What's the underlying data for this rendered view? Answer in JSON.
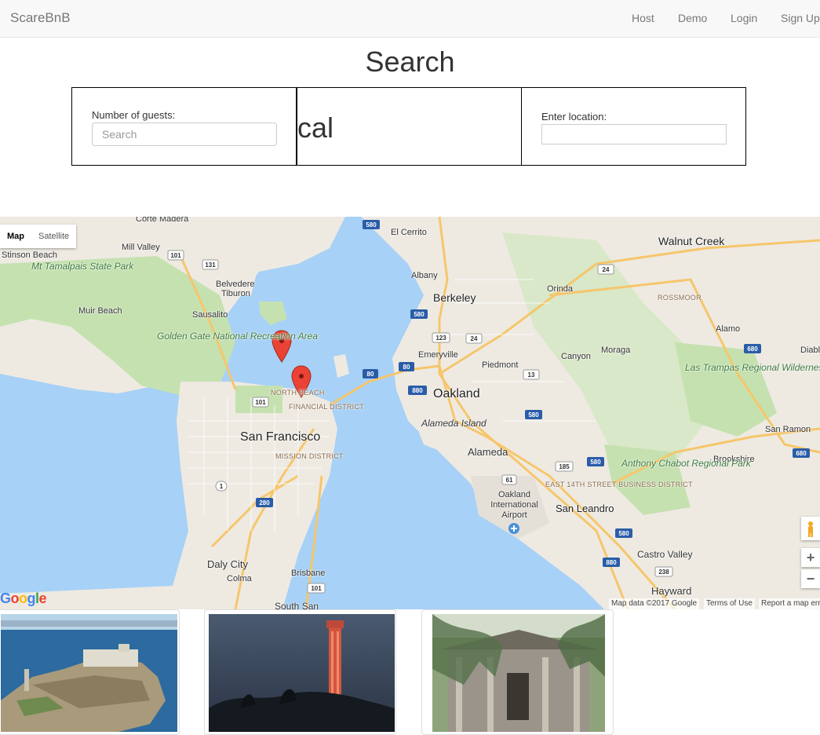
{
  "navbar": {
    "brand": "ScareBnB",
    "links": [
      "Host",
      "Demo",
      "Login",
      "Sign Up"
    ]
  },
  "page_title": "Search",
  "search": {
    "guests_label": "Number of guests:",
    "guests_placeholder": "Search",
    "calendar_text": "cal",
    "location_label": "Enter location:",
    "location_value": ""
  },
  "map": {
    "type_controls": [
      "Map",
      "Satellite"
    ],
    "active_type": "Map",
    "labels": {
      "corte_madera": "Corte Madera",
      "mill_valley": "Mill Valley",
      "stinson_beach": "Stinson Beach",
      "mt_tamalpais": "Mt Tamalpais State Park",
      "belvedere": "Belvedere",
      "tiburon": "Tiburon",
      "muir_beach": "Muir Beach",
      "sausalito": "Sausalito",
      "golden_gate": "Golden Gate National Recreation Area",
      "el_cerrito": "El Cerrito",
      "albany": "Albany",
      "berkeley": "Berkeley",
      "walnut_creek": "Walnut Creek",
      "orinda": "Orinda",
      "rossmoor": "ROSSMOOR",
      "alamo": "Alamo",
      "moraga": "Moraga",
      "canyon": "Canyon",
      "piedmont": "Piedmont",
      "emeryville": "Emeryville",
      "oakland": "Oakland",
      "las_trampas": "Las Trampas Regional Wilderness",
      "diablo": "Diabl",
      "san_ramon": "San Ramon",
      "alameda_island": "Alameda Island",
      "alameda": "Alameda",
      "brookshire": "Brookshire",
      "anthony_chabot": "Anthony Chabot Regional Park",
      "north_beach": "NORTH BEACH",
      "financial_district": "FINANCIAL DISTRICT",
      "san_francisco": "San Francisco",
      "mission_district": "MISSION DISTRICT",
      "oakland_airport": "Oakland International Airport",
      "east_14th": "EAST 14TH STREET BUSINESS DISTRICT",
      "san_leandro": "San Leandro",
      "castro_valley": "Castro Valley",
      "daly_city": "Daly City",
      "colma": "Colma",
      "brisbane": "Brisbane",
      "hayward": "Hayward",
      "south_san": "South San"
    },
    "shields": [
      "580",
      "101",
      "131",
      "24",
      "580",
      "123",
      "24",
      "80",
      "80",
      "13",
      "880",
      "580",
      "101",
      "680",
      "680",
      "580",
      "1",
      "280",
      "61",
      "185",
      "580",
      "880",
      "238",
      "101"
    ],
    "google_logo": "Google",
    "footer_items": [
      "Map data ©2017 Google",
      "Terms of Use",
      "Report a map err"
    ]
  },
  "listing_images": [
    {
      "subject": "alcatraz-island"
    },
    {
      "subject": "coit-tower"
    },
    {
      "subject": "abandoned-house"
    }
  ],
  "colors": {
    "water": "#a7d1f7",
    "land": "#eeeae2",
    "park": "#c5e1b0",
    "highway": "#f6c66b",
    "marker": "#ea4335"
  }
}
